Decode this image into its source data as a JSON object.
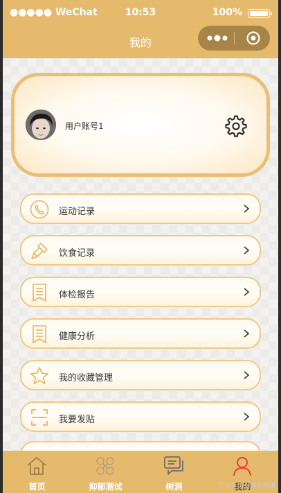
{
  "status_bar": {
    "carrier": "●●●●● WeChat",
    "time": "10:53",
    "battery": "100%"
  },
  "nav": {
    "title": "我的"
  },
  "profile": {
    "username": "用户账号1"
  },
  "menu": [
    {
      "label": "运动记录",
      "icon": "phone-icon"
    },
    {
      "label": "饮食记录",
      "icon": "brush-icon"
    },
    {
      "label": "体检报告",
      "icon": "report-icon"
    },
    {
      "label": "健康分析",
      "icon": "analysis-icon"
    },
    {
      "label": "我的收藏管理",
      "icon": "star-icon"
    },
    {
      "label": "我要发贴",
      "icon": "scan-icon"
    }
  ],
  "tabs": [
    {
      "label": "首页",
      "icon": "home-icon"
    },
    {
      "label": "抑郁测试",
      "icon": "test-icon"
    },
    {
      "label": "树洞",
      "icon": "chat-icon"
    },
    {
      "label": "我的",
      "icon": "user-icon"
    }
  ],
  "watermark": "CSDN @计算机学姐",
  "colors": {
    "theme": "#e6ba6d",
    "card_border": "#eec98a",
    "active_tab_icon": "#e0413a"
  }
}
